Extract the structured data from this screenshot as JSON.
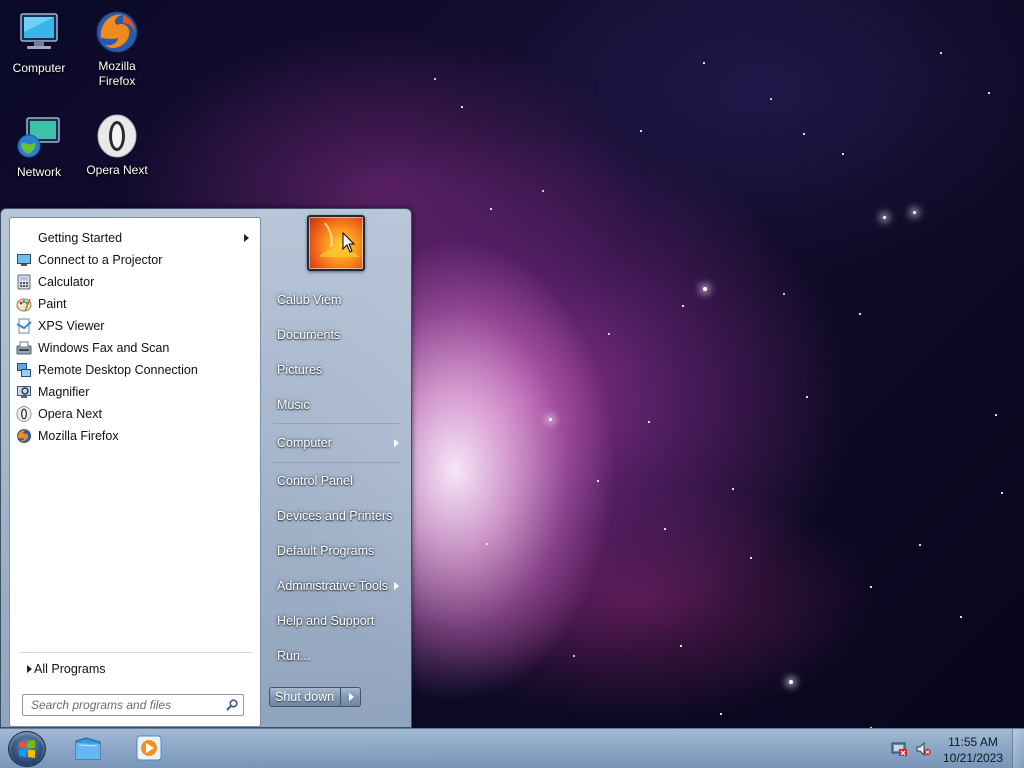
{
  "desktop": {
    "icons": [
      {
        "label_line1": "Computer",
        "label_line2": ""
      },
      {
        "label_line1": "Mozilla",
        "label_line2": "Firefox"
      },
      {
        "label_line1": "Network",
        "label_line2": ""
      },
      {
        "label_line1": "Opera Next",
        "label_line2": ""
      }
    ]
  },
  "start_menu": {
    "programs": [
      {
        "label": "Getting Started",
        "icon": "getting-started-icon",
        "has_submenu": true
      },
      {
        "label": "Connect to a Projector",
        "icon": "projector-icon"
      },
      {
        "label": "Calculator",
        "icon": "calculator-icon"
      },
      {
        "label": "Paint",
        "icon": "paint-icon"
      },
      {
        "label": "XPS Viewer",
        "icon": "xps-viewer-icon"
      },
      {
        "label": "Windows Fax and Scan",
        "icon": "fax-scan-icon"
      },
      {
        "label": "Remote Desktop Connection",
        "icon": "remote-desktop-icon"
      },
      {
        "label": "Magnifier",
        "icon": "magnifier-icon"
      },
      {
        "label": "Opera Next",
        "icon": "opera-icon"
      },
      {
        "label": "Mozilla Firefox",
        "icon": "firefox-icon"
      }
    ],
    "all_programs_label": "All Programs",
    "search_placeholder": "Search programs and files",
    "right_items": [
      {
        "label": "Calub Viem"
      },
      {
        "label": "Documents"
      },
      {
        "label": "Pictures"
      },
      {
        "label": "Music"
      },
      {
        "label": "Computer",
        "has_submenu": true
      },
      {
        "label": "Control Panel"
      },
      {
        "label": "Devices and Printers"
      },
      {
        "label": "Default Programs"
      },
      {
        "label": "Administrative Tools",
        "has_submenu": true
      },
      {
        "label": "Help and Support"
      },
      {
        "label": "Run..."
      }
    ],
    "shutdown_label": "Shut down"
  },
  "taskbar": {
    "pinned": [
      "file-explorer-icon",
      "media-player-icon"
    ],
    "clock_time": "11:55 AM",
    "clock_date": "10/21/2023"
  },
  "colors": {
    "accent": "#8298b2",
    "desktop_bg": "#0b0a2a",
    "nebula": "#a53ca0"
  }
}
